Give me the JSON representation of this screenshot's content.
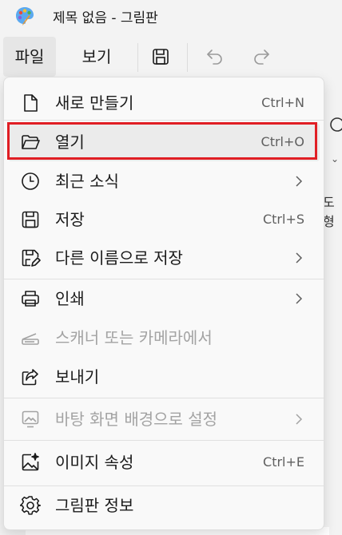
{
  "window": {
    "title": "제목 없음 - 그림판"
  },
  "menubar": {
    "file_label": "파일",
    "view_label": "보기"
  },
  "file_menu": {
    "items": [
      {
        "label": "새로 만들기",
        "shortcut": "Ctrl+N",
        "icon": "new-file-icon"
      },
      {
        "label": "열기",
        "shortcut": "Ctrl+O",
        "icon": "folder-open-icon",
        "highlighted": true
      },
      {
        "label": "최근 소식",
        "icon": "clock-icon",
        "submenu": true
      },
      {
        "label": "저장",
        "shortcut": "Ctrl+S",
        "icon": "save-icon"
      },
      {
        "label": "다른 이름으로 저장",
        "icon": "save-as-icon",
        "submenu": true
      },
      {
        "label": "인쇄",
        "icon": "printer-icon",
        "submenu": true
      },
      {
        "label": "스캐너 또는 카메라에서",
        "icon": "scanner-icon",
        "disabled": true
      },
      {
        "label": "보내기",
        "icon": "share-icon"
      },
      {
        "label": "바탕 화면 배경으로 설정",
        "icon": "wallpaper-icon",
        "submenu": true,
        "disabled": true
      },
      {
        "label": "이미지 속성",
        "shortcut": "Ctrl+E",
        "icon": "image-properties-icon"
      },
      {
        "label": "그림판 정보",
        "icon": "gear-icon"
      }
    ]
  },
  "background": {
    "partial_label": "도형"
  },
  "colors": {
    "highlight_border": "#e01e24",
    "disabled_text": "#a3a3a3"
  }
}
